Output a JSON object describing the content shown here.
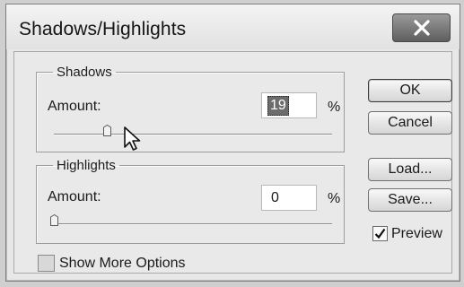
{
  "window": {
    "title": "Shadows/Highlights"
  },
  "shadows": {
    "legend": "Shadows",
    "amount_label": "Amount:",
    "amount_value": "19",
    "unit": "%",
    "slider_fraction": 0.19
  },
  "highlights": {
    "legend": "Highlights",
    "amount_label": "Amount:",
    "amount_value": "0",
    "unit": "%",
    "slider_fraction": 0.0
  },
  "buttons": {
    "ok": "OK",
    "cancel": "Cancel",
    "load": "Load...",
    "save": "Save..."
  },
  "preview": {
    "label": "Preview",
    "checked": true
  },
  "show_more": {
    "label": "Show More Options",
    "checked": false
  },
  "icons": {
    "close": "close-icon",
    "cursor": "mouse-pointer-icon",
    "check": "check-icon"
  }
}
